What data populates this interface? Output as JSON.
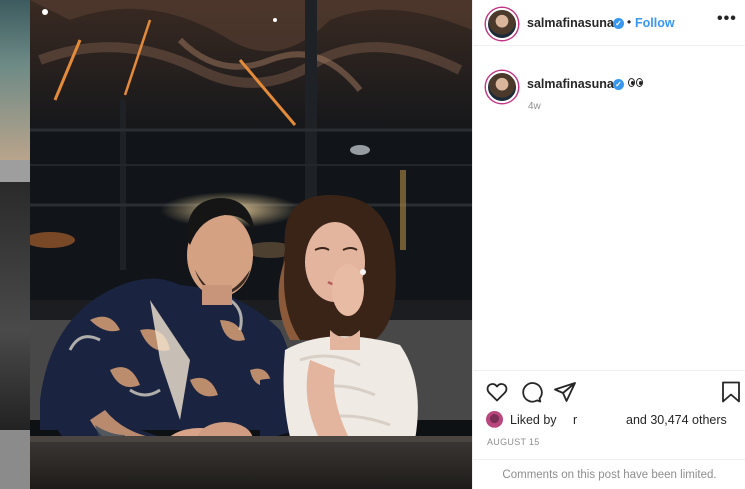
{
  "post": {
    "username": "salmafinasunan",
    "verified_glyph": "✓",
    "dot": "•",
    "follow_label": "Follow",
    "more_label": "•••",
    "caption_emoji": "eyes-emoji",
    "time_ago": "4w",
    "liked_label": "Liked by",
    "liked_user": "r",
    "liked_rest": "and 30,474 others",
    "date": "AUGUST 15",
    "comments_limited": "Comments on this post have been limited."
  },
  "icons": {
    "like": "heart-icon",
    "comment": "comment-icon",
    "share": "share-icon",
    "save": "bookmark-icon"
  },
  "colors": {
    "accent": "#3897f0",
    "muted": "#8e8e8e",
    "border": "#efefef",
    "text": "#262626"
  }
}
